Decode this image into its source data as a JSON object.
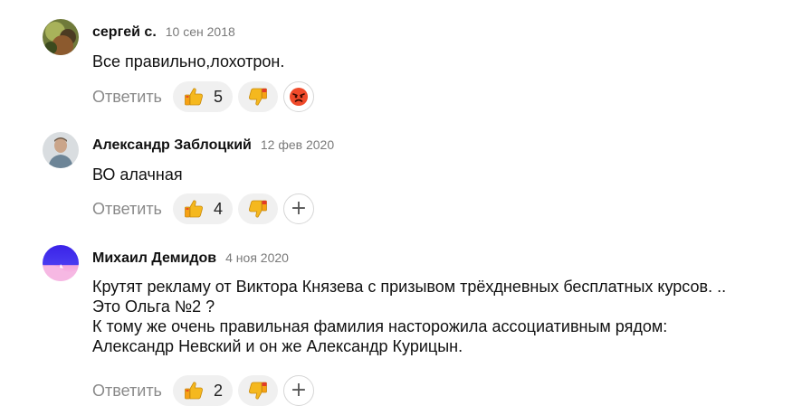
{
  "comments": [
    {
      "author": "сергей с.",
      "date": "10 сен 2018",
      "text_lines": [
        "Все правильно,лохотрон."
      ],
      "reply_label": "Ответить",
      "likes": "5",
      "avatar_icon": "user-photo-avatar",
      "extra_reaction_icon": "angry-face-icon"
    },
    {
      "author": "Александр Заблоцкий",
      "date": "12 фев 2020",
      "text_lines": [
        "ВО алачная"
      ],
      "reply_label": "Ответить",
      "likes": "4",
      "avatar_icon": "user-photo-avatar",
      "extra_reaction_icon": "add-reaction-icon"
    },
    {
      "author": "Михаил Демидов",
      "date": "4 ноя 2020",
      "text_lines": [
        "Крутят рекламу от Виктора Князева с призывом трёхдневных бесплатных курсов. ..",
        "Это Ольга №2 ?",
        "К тому же очень правильная фамилия насторожила ассоциативным рядом:",
        "Александр Невский и он же Александр Курицын."
      ],
      "reply_label": "Ответить",
      "likes": "2",
      "avatar_icon": "default-gradient-avatar",
      "extra_reaction_icon": "add-reaction-icon"
    }
  ],
  "icons": {
    "like": "thumbs-up-icon",
    "dislike": "thumbs-down-icon",
    "add": "plus-icon"
  },
  "colors": {
    "author": "#111111",
    "date": "#7a7a7a",
    "reply": "#8a8a8a",
    "pill_bg": "#f0f0f0",
    "thumb": "#f5b81e",
    "dislike_accent": "#e23b27",
    "avatar_gradient_top": "#3a22e8",
    "avatar_gradient_bottom": "#f2a0d8"
  }
}
